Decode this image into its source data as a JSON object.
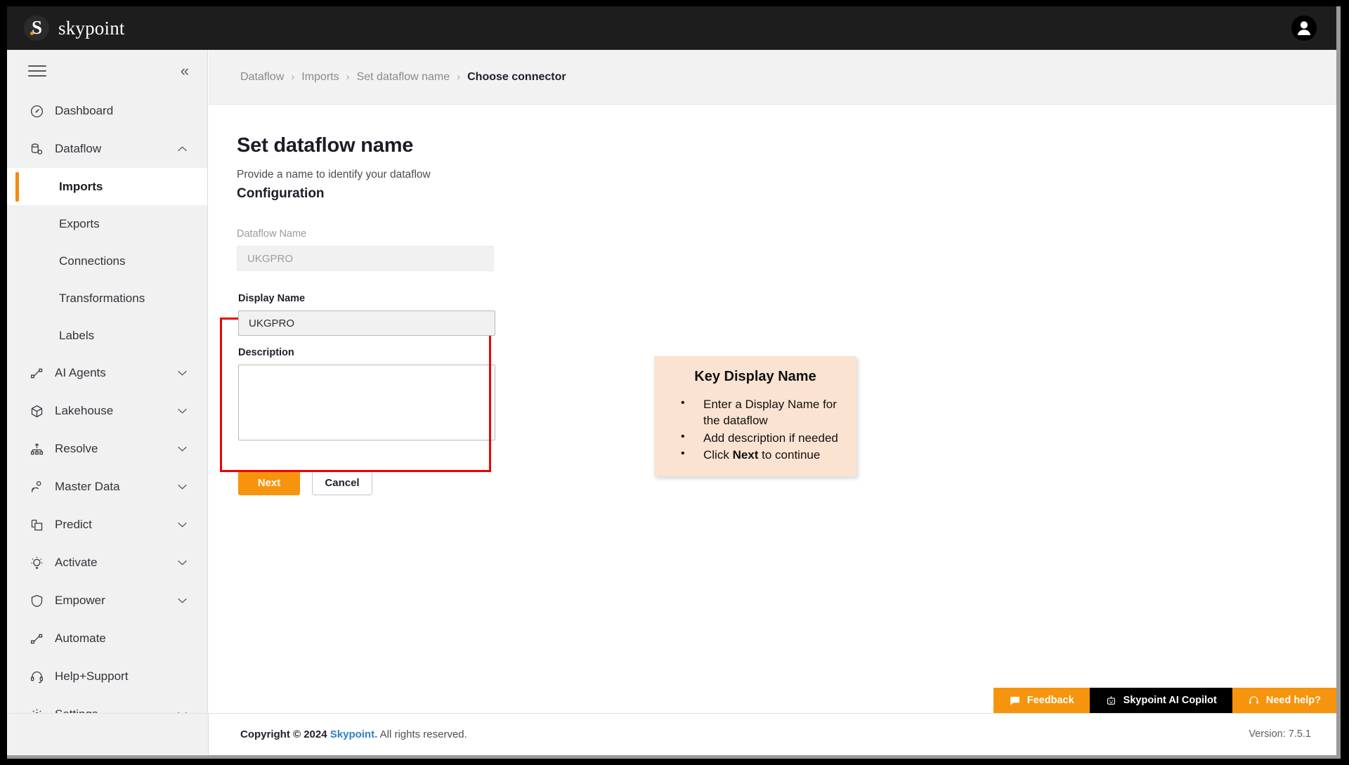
{
  "topbar": {
    "brand_letter": "S",
    "brand_name": "skypoint",
    "avatar_name": "user-avatar"
  },
  "sidebar": {
    "collapse_label": "«",
    "items": [
      {
        "label": "Dashboard",
        "icon": "dashboard-icon",
        "chevron": ""
      },
      {
        "label": "Dataflow",
        "icon": "dataflow-icon",
        "chevron": "⌃"
      }
    ],
    "dataflow_children": [
      {
        "label": "Imports",
        "active": true
      },
      {
        "label": "Exports",
        "active": false
      },
      {
        "label": "Connections",
        "active": false
      },
      {
        "label": "Transformations",
        "active": false
      },
      {
        "label": "Labels",
        "active": false
      }
    ],
    "lower_items": [
      {
        "label": "AI Agents",
        "icon": "ai-agents-icon",
        "chevron": "⌄"
      },
      {
        "label": "Lakehouse",
        "icon": "lakehouse-icon",
        "chevron": "⌄"
      },
      {
        "label": "Resolve",
        "icon": "resolve-icon",
        "chevron": "⌄"
      },
      {
        "label": "Master Data",
        "icon": "master-data-icon",
        "chevron": "⌄"
      },
      {
        "label": "Predict",
        "icon": "predict-icon",
        "chevron": "⌄"
      },
      {
        "label": "Activate",
        "icon": "activate-icon",
        "chevron": "⌄"
      },
      {
        "label": "Empower",
        "icon": "empower-icon",
        "chevron": "⌄"
      },
      {
        "label": "Automate",
        "icon": "automate-icon",
        "chevron": ""
      },
      {
        "label": "Help+Support",
        "icon": "help-support-icon",
        "chevron": ""
      },
      {
        "label": "Settings",
        "icon": "settings-icon",
        "chevron": "⌄"
      }
    ]
  },
  "breadcrumb": {
    "items": [
      "Dataflow",
      "Imports",
      "Set dataflow name",
      "Choose connector"
    ],
    "separator": "›"
  },
  "main": {
    "title": "Set dataflow name",
    "subtitle": "Provide a name to identify your dataflow",
    "section_heading": "Configuration",
    "dataflow_name": {
      "label": "Dataflow Name",
      "value": "UKGPRO",
      "placeholder": "UKGPRO"
    },
    "display_name": {
      "label": "Display Name",
      "value": "UKGPRO",
      "placeholder": ""
    },
    "description": {
      "label": "Description",
      "value": "",
      "placeholder": ""
    },
    "next_label": "Next",
    "cancel_label": "Cancel"
  },
  "callout": {
    "title": "Key Display Name",
    "bullets": [
      {
        "pre": "Enter a Display Name for the dataflow",
        "bold": "",
        "post": ""
      },
      {
        "pre": "Add description if needed",
        "bold": "",
        "post": ""
      },
      {
        "pre": "Click ",
        "bold": "Next",
        "post": " to continue"
      }
    ]
  },
  "helpbar": {
    "feedback": "Feedback",
    "copilot": "Skypoint AI Copilot",
    "need_help": "Need help?"
  },
  "footer": {
    "copyright_pre": "Copyright © 2024 ",
    "copyright_link": "Skypoint.",
    "copyright_post": " All rights reserved.",
    "version": "Version: 7.5.1"
  },
  "colors": {
    "accent_orange": "#f7940d",
    "highlight_red": "#ee0000",
    "callout_bg": "#fbe3d2",
    "topbar_bg": "#1d1d1d",
    "sidebar_bg": "#f1f1f1",
    "link_blue": "#2f7fc1"
  }
}
